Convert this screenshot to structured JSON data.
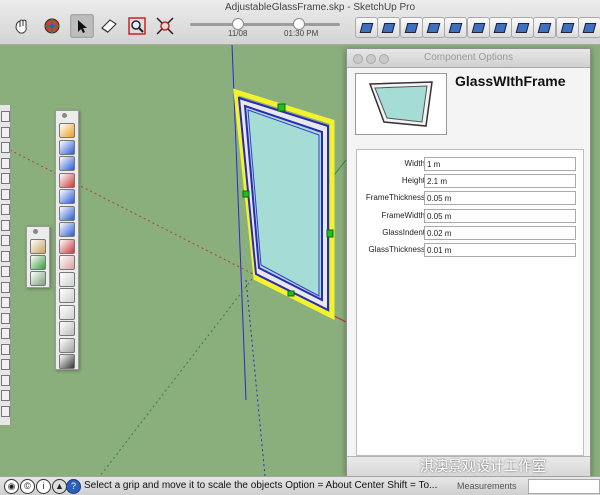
{
  "window": {
    "title": "AdjustableGlassFrame.skp - SketchUp Pro"
  },
  "toolbar": {
    "tools": [
      {
        "icon": "orbit-hand-icon"
      },
      {
        "icon": "components-icon"
      },
      {
        "icon": "select-arrow-icon",
        "selected": true
      },
      {
        "icon": "eraser-icon"
      },
      {
        "icon": "zoom-extents-icon"
      },
      {
        "icon": "scale-icon"
      }
    ],
    "shadow_time": {
      "start_label": "11/08",
      "end_label": "01:30 PM"
    },
    "view_buttons": [
      "iso-view",
      "top-view",
      "front-view",
      "right-view",
      "back-view",
      "left-view",
      "xray-view",
      "wireframe-view",
      "hidden-line-view",
      "shaded-view",
      "textured-view"
    ]
  },
  "dialog": {
    "title": "Component Options",
    "component_name": "GlassWIthFrame",
    "options": [
      {
        "label": "Width",
        "value": "1 m"
      },
      {
        "label": "Height",
        "value": "2.1 m"
      },
      {
        "label": "FrameThickness",
        "value": "0.05 m"
      },
      {
        "label": "FrameWidth",
        "value": "0.05 m"
      },
      {
        "label": "GlassIndent",
        "value": "0.02 m"
      },
      {
        "label": "GlassThickness",
        "value": "0.01 m"
      }
    ]
  },
  "status_bar": {
    "message": "Select a grip and move it to scale the objects  Option = About Center  Shift = To...",
    "measurements_label": "Measurements",
    "measurements_value": ""
  },
  "watermark": "淇澳景观设计工作室",
  "colors": {
    "canvas": "#8aae7c",
    "glass": "#a6dcd6",
    "frame": "#2a2ab8",
    "selection": "#f2f22e",
    "grip": "#1fbf1f"
  }
}
